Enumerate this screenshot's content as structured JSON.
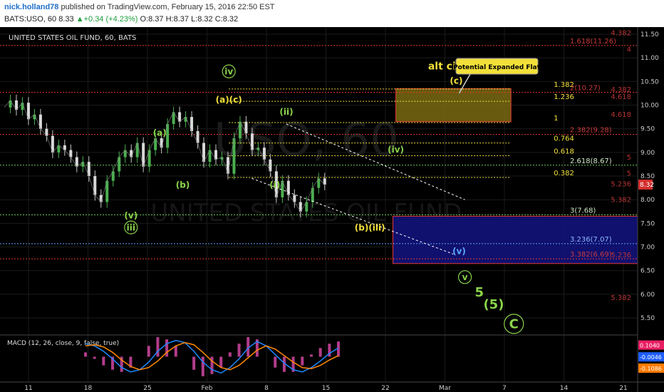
{
  "header": {
    "author": "nick.holland78",
    "published": "published on TradingView.com, February 15, 2016 22:50 EST",
    "symbol": "BATS:USO, 60",
    "last": "8.33",
    "change": "+0.34 (+4.23%)",
    "open": "O:8.37",
    "high": "H:8.37",
    "low": "L:8.32",
    "close": "C:8.32"
  },
  "chart_data": {
    "type": "candlestick",
    "title": "UNITED STATES OIL FUND, 60, BATS",
    "watermark_symbol": "USO, 60",
    "watermark_name": "UNITED STATES OIL FUND",
    "ylim": [
      5.2,
      11.65
    ],
    "y_ticks": [
      "11.50",
      "11.00",
      "10.50",
      "10.00",
      "9.50",
      "9.00",
      "8.50",
      "8.00",
      "7.50",
      "7.00",
      "6.50",
      "6.00",
      "5.50"
    ],
    "x_ticks": [
      "11",
      "18",
      "25",
      "Feb",
      "8",
      "15",
      "22",
      "Mar",
      "7",
      "14",
      "21"
    ],
    "last_price_label": "8.32",
    "price_path": [
      [
        0,
        9.95
      ],
      [
        1,
        10.1
      ],
      [
        2,
        9.9
      ],
      [
        3,
        10.05
      ],
      [
        4,
        9.7
      ],
      [
        5,
        9.8
      ],
      [
        6,
        9.5
      ],
      [
        7,
        9.35
      ],
      [
        8,
        9.0
      ],
      [
        9,
        9.15
      ],
      [
        10,
        9.05
      ],
      [
        11,
        8.9
      ],
      [
        12,
        8.7
      ],
      [
        13,
        8.8
      ],
      [
        14,
        8.5
      ],
      [
        15,
        8.1
      ],
      [
        16,
        7.95
      ],
      [
        17,
        8.4
      ],
      [
        18,
        8.6
      ],
      [
        19,
        8.9
      ],
      [
        20,
        9.05
      ],
      [
        21,
        8.9
      ],
      [
        22,
        9.2
      ],
      [
        23,
        8.7
      ],
      [
        24,
        9.05
      ],
      [
        25,
        9.3
      ],
      [
        26,
        9.1
      ],
      [
        27,
        9.6
      ],
      [
        28,
        9.85
      ],
      [
        29,
        9.65
      ],
      [
        30,
        9.75
      ],
      [
        31,
        9.45
      ],
      [
        32,
        9.2
      ],
      [
        33,
        8.8
      ],
      [
        34,
        9.05
      ],
      [
        35,
        8.85
      ],
      [
        36,
        8.9
      ],
      [
        37,
        8.55
      ],
      [
        38,
        9.3
      ],
      [
        39,
        9.65
      ],
      [
        40,
        9.4
      ],
      [
        41,
        9.05
      ],
      [
        42,
        9.1
      ],
      [
        43,
        8.85
      ],
      [
        44,
        8.6
      ],
      [
        45,
        8.05
      ],
      [
        46,
        8.4
      ],
      [
        47,
        8.1
      ],
      [
        48,
        7.95
      ],
      [
        49,
        7.75
      ],
      [
        50,
        7.95
      ],
      [
        51,
        8.25
      ],
      [
        52,
        8.45
      ],
      [
        53,
        8.32
      ]
    ],
    "x_range": [
      0,
      110
    ],
    "fib_levels": [
      {
        "label": "1.382",
        "value": 10.34
      },
      {
        "label": "1.236",
        "value": 10.08
      },
      {
        "label": "1",
        "value": 9.63
      },
      {
        "label": "0.764",
        "value": 9.2
      },
      {
        "label": "0.618",
        "value": 8.93
      },
      {
        "label": "0.382",
        "value": 8.47
      }
    ],
    "extension_levels": [
      {
        "label": "1.618(11.26)",
        "value": 11.26
      },
      {
        "label": "2(10.27)",
        "value": 10.27
      },
      {
        "label": "2.382(9.28)",
        "value": 9.38
      },
      {
        "label": "2.618(8.67)",
        "value": 8.73
      },
      {
        "label": "3(7.68)",
        "value": 7.68
      },
      {
        "label": "3.236(7.07)",
        "value": 7.07
      },
      {
        "label": "3.382(6.69)",
        "value": 6.75
      }
    ],
    "right_levels": [
      {
        "label": "4.382",
        "value": 11.45
      },
      {
        "label": "4",
        "value": 11.1
      },
      {
        "label": "4.382",
        "value": 10.25
      },
      {
        "label": "4.618",
        "value": 10.1
      },
      {
        "label": "4.618",
        "value": 9.72
      },
      {
        "label": "5",
        "value": 8.82
      },
      {
        "label": "5.236",
        "value": 8.25
      },
      {
        "label": "5",
        "value": 8.48
      },
      {
        "label": "5.382",
        "value": 7.92
      },
      {
        "label": "5.236",
        "value": 6.75
      },
      {
        "label": "5.382",
        "value": 5.85
      }
    ],
    "wave_labels": [
      {
        "text": "(a)",
        "x": 27,
        "y": 9.35,
        "color": "#8bd44a"
      },
      {
        "text": "(b)",
        "x": 31,
        "y": 8.25,
        "color": "#8bd44a"
      },
      {
        "text": "(v)",
        "x": 22,
        "y": 7.6,
        "color": "#8bd44a"
      },
      {
        "text": "iii",
        "x": 22,
        "y": 7.35,
        "color": "#8bd44a",
        "circle": true
      },
      {
        "text": "iv",
        "x": 39,
        "y": 10.65,
        "color": "#8bd44a",
        "circle": true
      },
      {
        "text": "(a)(c)",
        "x": 39,
        "y": 10.05,
        "color": "#f2e03a"
      },
      {
        "text": "(ii)",
        "x": 49,
        "y": 9.8,
        "color": "#8bd44a"
      },
      {
        "text": "(i)",
        "x": 47,
        "y": 8.25,
        "color": "#8bd44a"
      },
      {
        "text": "(iv)",
        "x": 68,
        "y": 9.0,
        "color": "#8bd44a"
      },
      {
        "text": "(b)(iii)",
        "x": 63.5,
        "y": 7.35,
        "color": "#f2e03a"
      },
      {
        "text": "(v)",
        "x": 79,
        "y": 6.85,
        "color": "#5aa7ff"
      },
      {
        "text": "v",
        "x": 80,
        "y": 6.3,
        "color": "#8bd44a",
        "circle": true
      },
      {
        "text": "5",
        "x": 82.5,
        "y": 5.95,
        "color": "#8bd44a"
      },
      {
        "text": "(5)",
        "x": 85,
        "y": 5.7,
        "color": "#8bd44a"
      },
      {
        "text": "C",
        "x": 88.5,
        "y": 5.28,
        "color": "#8bd44a",
        "circle": true
      },
      {
        "text": "alt circle iv",
        "x": 79,
        "y": 10.75,
        "color": "#f2e03a"
      },
      {
        "text": "(c)",
        "x": 78.5,
        "y": 10.45,
        "color": "#f2e03a"
      }
    ],
    "callout": "Potential Expanded Flat",
    "yellow_box": {
      "x0": 68,
      "x1": 88,
      "y0": 9.65,
      "y1": 10.35
    },
    "blue_box": {
      "x0": 67.5,
      "x1": 114,
      "y0": 6.65,
      "y1": 7.65
    },
    "channel": {
      "upper": [
        [
          49,
          9.6
        ],
        [
          80,
          8.0
        ]
      ],
      "lower": [
        [
          43,
          8.45
        ],
        [
          78,
          6.85
        ]
      ]
    },
    "macd": {
      "title": "MACD (12, 26, close, 9, false, true)",
      "ylim": [
        -0.22,
        0.2
      ],
      "labels": [
        {
          "text": "0.1040",
          "value": 0.104,
          "color": "#e91e63"
        },
        {
          "text": "-0.0046",
          "value": -0.0046,
          "color": "#1e5eff"
        },
        {
          "text": "-0.1086",
          "value": -0.1086,
          "color": "#ff7b00"
        }
      ],
      "macd_line": [
        0.12,
        0.1,
        0.05,
        -0.02,
        -0.1,
        -0.14,
        -0.12,
        -0.05,
        0.05,
        0.12,
        0.15,
        0.13,
        0.05,
        -0.05,
        -0.12,
        -0.15,
        -0.1,
        -0.02,
        0.08,
        0.14,
        0.1,
        0.02,
        -0.06,
        -0.12,
        -0.14,
        -0.1,
        -0.04,
        0.03,
        0.08
      ],
      "signal_line": [
        0.1,
        0.11,
        0.09,
        0.04,
        -0.03,
        -0.09,
        -0.12,
        -0.1,
        -0.04,
        0.04,
        0.1,
        0.13,
        0.11,
        0.04,
        -0.04,
        -0.1,
        -0.12,
        -0.08,
        -0.01,
        0.06,
        0.1,
        0.07,
        0.01,
        -0.05,
        -0.1,
        -0.11,
        -0.08,
        -0.03,
        0.01
      ]
    }
  }
}
